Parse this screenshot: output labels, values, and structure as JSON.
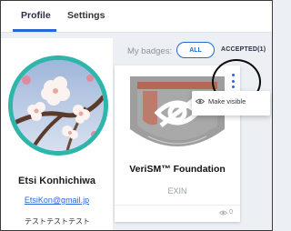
{
  "tabs": [
    {
      "label": "Profile",
      "active": true
    },
    {
      "label": "Settings",
      "active": false
    }
  ],
  "profile": {
    "name": "Etsi Konhichiwa",
    "email": "EtsiKon@gmail.jp",
    "bio": "テストテストテスト",
    "avatar_icon": "plum-blossom-photo"
  },
  "badges": {
    "label": "My badges:",
    "filter_all": "ALL",
    "filter_accepted": "ACCEPTED(1)",
    "cards": [
      {
        "title": "VeriSM™ Foundation",
        "issuer": "EXIN",
        "views": "0",
        "views_icon": "eye-icon"
      }
    ]
  },
  "menu": {
    "items": [
      {
        "label": "Make visible",
        "icon": "eye-icon"
      }
    ]
  },
  "colors": {
    "accent": "#2a66d9",
    "avatar_ring": "#2fb5a9",
    "badge_gray": "#9a9a9a",
    "badge_rust": "#b5543a"
  }
}
